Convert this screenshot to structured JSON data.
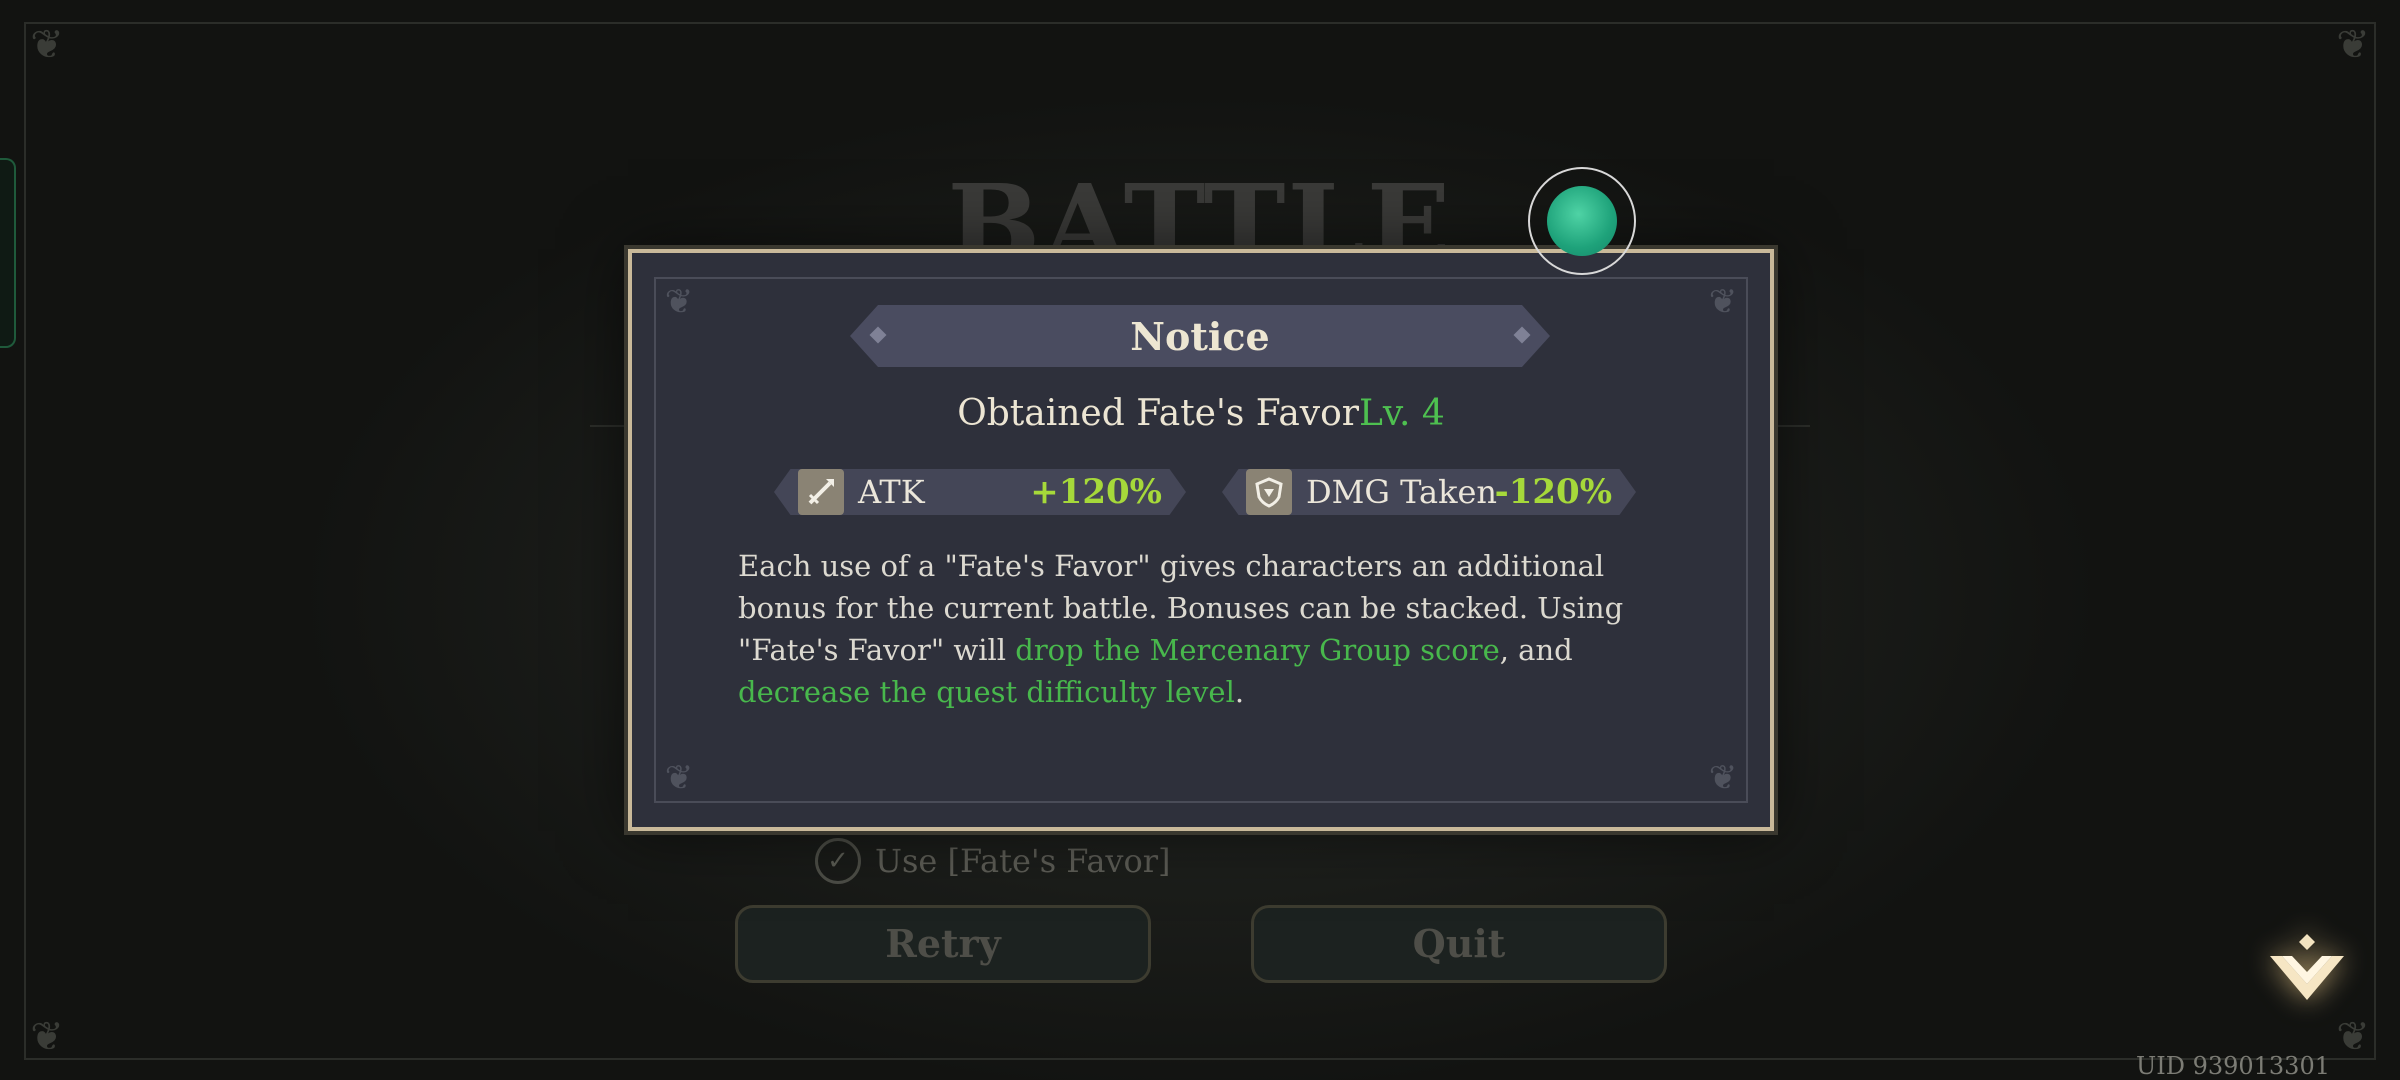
{
  "background": {
    "title": "BATTLE ENDS",
    "checkbox_label": "Use [Fate's Favor]",
    "checkbox_mark": "✓",
    "retry_label": "Retry",
    "quit_label": "Quit",
    "uid": "UID 939013301"
  },
  "dialog": {
    "title": "Notice",
    "obtained_text": "Obtained Fate's Favor",
    "level_text": "Lv. 4",
    "stats": [
      {
        "label": "ATK",
        "value": "+120%",
        "icon": "sword-icon"
      },
      {
        "label": "DMG Taken",
        "value": "-120%",
        "icon": "shield-icon"
      }
    ],
    "description": {
      "part1": "Each use of a \"Fate's Favor\" gives characters an additional bonus for the current battle. Bonuses can be stacked. Using \"Fate's Favor\" will ",
      "highlight1": "drop the Mercenary Group score",
      "part2": ", and ",
      "highlight2": "decrease the quest difficulty level",
      "part3": "."
    }
  },
  "colors": {
    "accent_green": "#48b84c",
    "stat_value": "#a6d93a",
    "dialog_border": "#c9b99a",
    "dialog_bg": "#2e303b"
  }
}
